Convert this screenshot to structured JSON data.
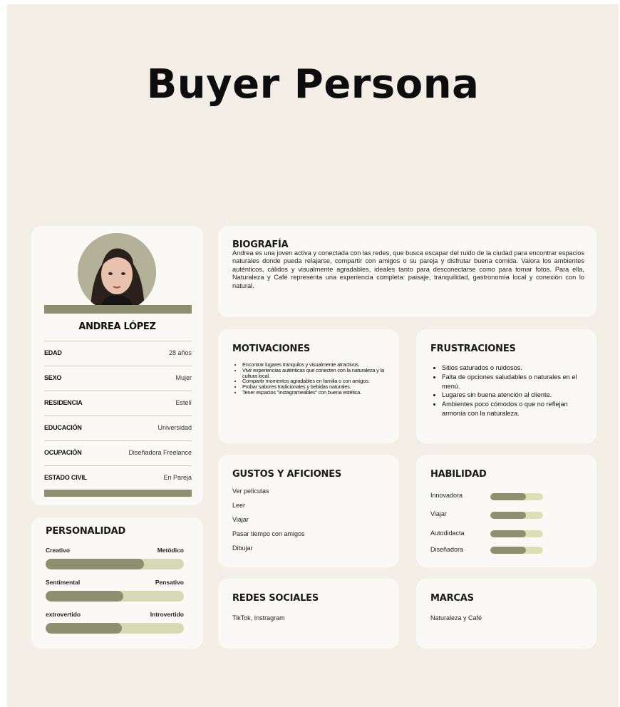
{
  "title": "Buyer Persona",
  "profile": {
    "name": "ANDREA LÓPEZ",
    "fields": [
      {
        "label": "EDAD",
        "value": "28 años"
      },
      {
        "label": "SEXO",
        "value": "Mujer"
      },
      {
        "label": "RESIDENCIA",
        "value": "Estelí"
      },
      {
        "label": "EDUCACIÓN",
        "value": "Universidad"
      },
      {
        "label": "OCUPACIÓN",
        "value": "Diseñadora Freelance"
      },
      {
        "label": "ESTADO CIVIL",
        "value": "En Pareja"
      }
    ]
  },
  "personality": {
    "heading": "PERSONALIDAD",
    "traits": [
      {
        "left": "Creativo",
        "right": "Metódico",
        "level": 0.71
      },
      {
        "left": "Sentimental",
        "right": "Pensativo",
        "level": 0.56
      },
      {
        "left": "extrovertido",
        "right": "Introvertido",
        "level": 0.55
      }
    ]
  },
  "biography": {
    "heading": "BIOGRAFÍA",
    "text": "Andrea es una joven activa y conectada con las redes, que busca escapar del ruido de la ciudad para encontrar espacios naturales donde pueda relajarse, compartir con amigos o su pareja y disfrutar buena comida. Valora los ambientes auténticos, cálidos y visualmente agradables, ideales tanto para desconectarse como para tomar fotos. Para ella, Naturaleza y Café representa una experiencia completa: paisaje, tranquilidad, gastronomía local y conexión con lo natural."
  },
  "motivations": {
    "heading": "MOTIVACIONES",
    "items": [
      "Encontrar lugares tranquilos y visualmente atractivos.",
      "Vivir experiencias auténticas que conecten con la naturaleza y la cultura local.",
      "Compartir momentos agradables en familia o con amigos.",
      "Probar sabores tradicionales y bebidas naturales.",
      "Tener espacios \"instagrameables\" con buena estética."
    ]
  },
  "frustrations": {
    "heading": "FRUSTRACIONES",
    "items": [
      "Sitios saturados o ruidosos.",
      "Falta de opciones saludables o naturales en el menú.",
      "Lugares sin buena atención al cliente.",
      "Ambientes poco cómodos o que no reflejan armonía con la naturaleza."
    ]
  },
  "hobbies": {
    "heading": "GUSTOS Y AFICIONES",
    "items": [
      "Ver películas",
      "Leer",
      "Viajar",
      "Pasar tiempo con amigos",
      "Dibujar"
    ]
  },
  "skills": {
    "heading": "HABILIDAD",
    "items": [
      {
        "label": "Innovadora",
        "level": 0.68
      },
      {
        "label": "Viajar",
        "level": 0.68
      },
      {
        "label": "Autodidacta",
        "level": 0.68
      },
      {
        "label": "Diseñadora",
        "level": 0.68
      }
    ]
  },
  "social": {
    "heading": "REDES SOCIALES",
    "text": "TikTok, Instragram"
  },
  "brands": {
    "heading": "MARCAS",
    "text": "Naturaleza y Café"
  },
  "colors": {
    "background": "#f3efe6",
    "card": "#faf9f5",
    "accent": "#8d8f6e",
    "accent_light": "#d7d8b4"
  }
}
